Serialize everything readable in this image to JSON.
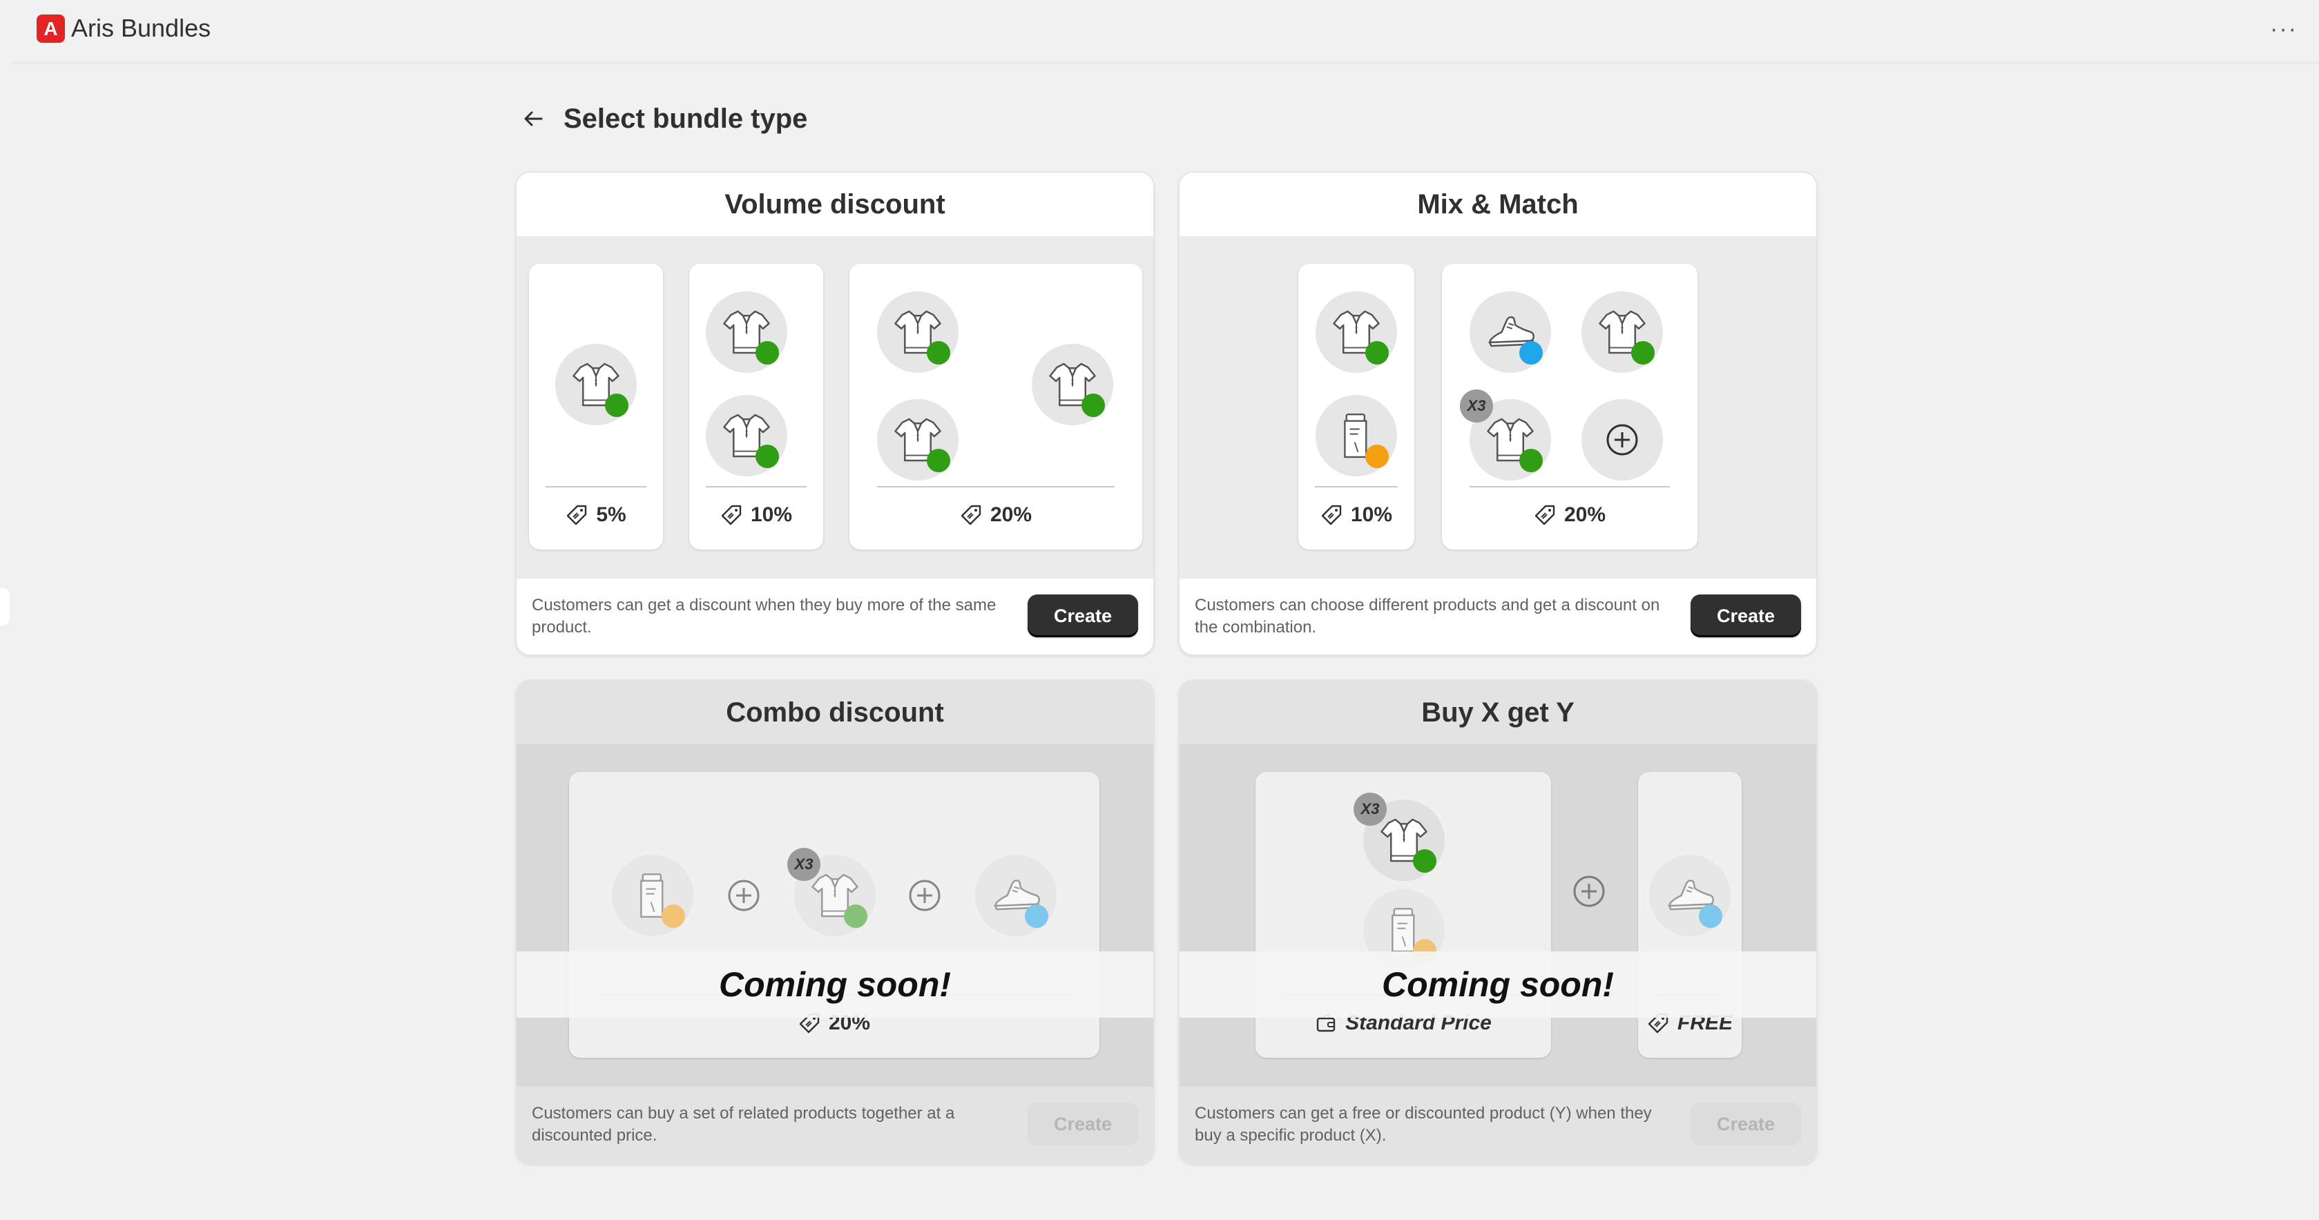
{
  "app": {
    "name": "Aris Bundles",
    "logo_letter": "A",
    "more_label": "···"
  },
  "page": {
    "title": "Select bundle type"
  },
  "cards": {
    "volume": {
      "title": "Volume discount",
      "tiers": [
        "5%",
        "10%",
        "20%"
      ],
      "description": "Customers can get a discount when they buy more of the same product.",
      "create_label": "Create"
    },
    "mix": {
      "title": "Mix & Match",
      "tiers": [
        "10%",
        "20%"
      ],
      "qty_badge": "X3",
      "description": "Customers can choose different products and get a discount on the combination.",
      "create_label": "Create"
    },
    "combo": {
      "title": "Combo discount",
      "price": "20%",
      "qty_badge": "X3",
      "coming_soon": "Coming soon!",
      "description": "Customers can buy a set of related products together at a discounted price.",
      "create_label": "Create"
    },
    "bxgy": {
      "title": "Buy X get Y",
      "price_x": "Standard Price",
      "price_y": "FREE",
      "qty_badge": "X3",
      "coming_soon": "Coming soon!",
      "description": "Customers can get a free or discounted product (Y) when they buy a specific product (X).",
      "create_label": "Create"
    }
  },
  "colors": {
    "green_dot": "#2f9e15",
    "blue_dot": "#1fa6e8",
    "orange_dot": "#f59f12",
    "primary_button": "#303030",
    "logo": "#e22424"
  },
  "icons": [
    "back-arrow-icon",
    "price-tag-icon",
    "wallet-icon",
    "shirt-icon",
    "sneaker-icon",
    "bottle-icon",
    "plus-circle-icon",
    "more-icon"
  ]
}
